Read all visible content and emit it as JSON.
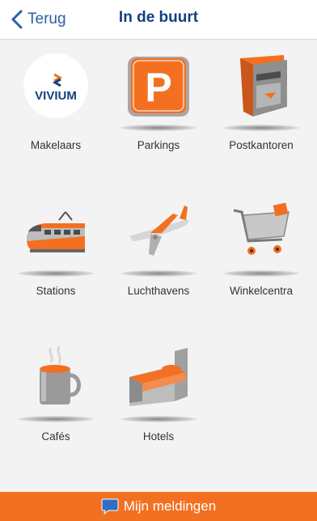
{
  "nav": {
    "back_label": "Terug",
    "title": "In de buurt"
  },
  "tiles": [
    {
      "label": "Makelaars",
      "icon": "vivium-logo-icon",
      "logo_text": "VIVIUM"
    },
    {
      "label": "Parkings",
      "icon": "parking-icon",
      "sign_text": "P"
    },
    {
      "label": "Postkantoren",
      "icon": "mailbox-icon"
    },
    {
      "label": "Stations",
      "icon": "train-icon"
    },
    {
      "label": "Luchthavens",
      "icon": "airplane-icon"
    },
    {
      "label": "Winkelcentra",
      "icon": "shopping-cart-icon"
    },
    {
      "label": "Cafés",
      "icon": "coffee-mug-icon"
    },
    {
      "label": "Hotels",
      "icon": "bed-icon"
    }
  ],
  "bottom_bar": {
    "label": "Mijn meldingen",
    "icon": "chat-bubble-icon"
  },
  "colors": {
    "accent": "#f37021",
    "nav_title": "#13407f",
    "back": "#2c5fa3",
    "background": "#f3f3f3"
  }
}
